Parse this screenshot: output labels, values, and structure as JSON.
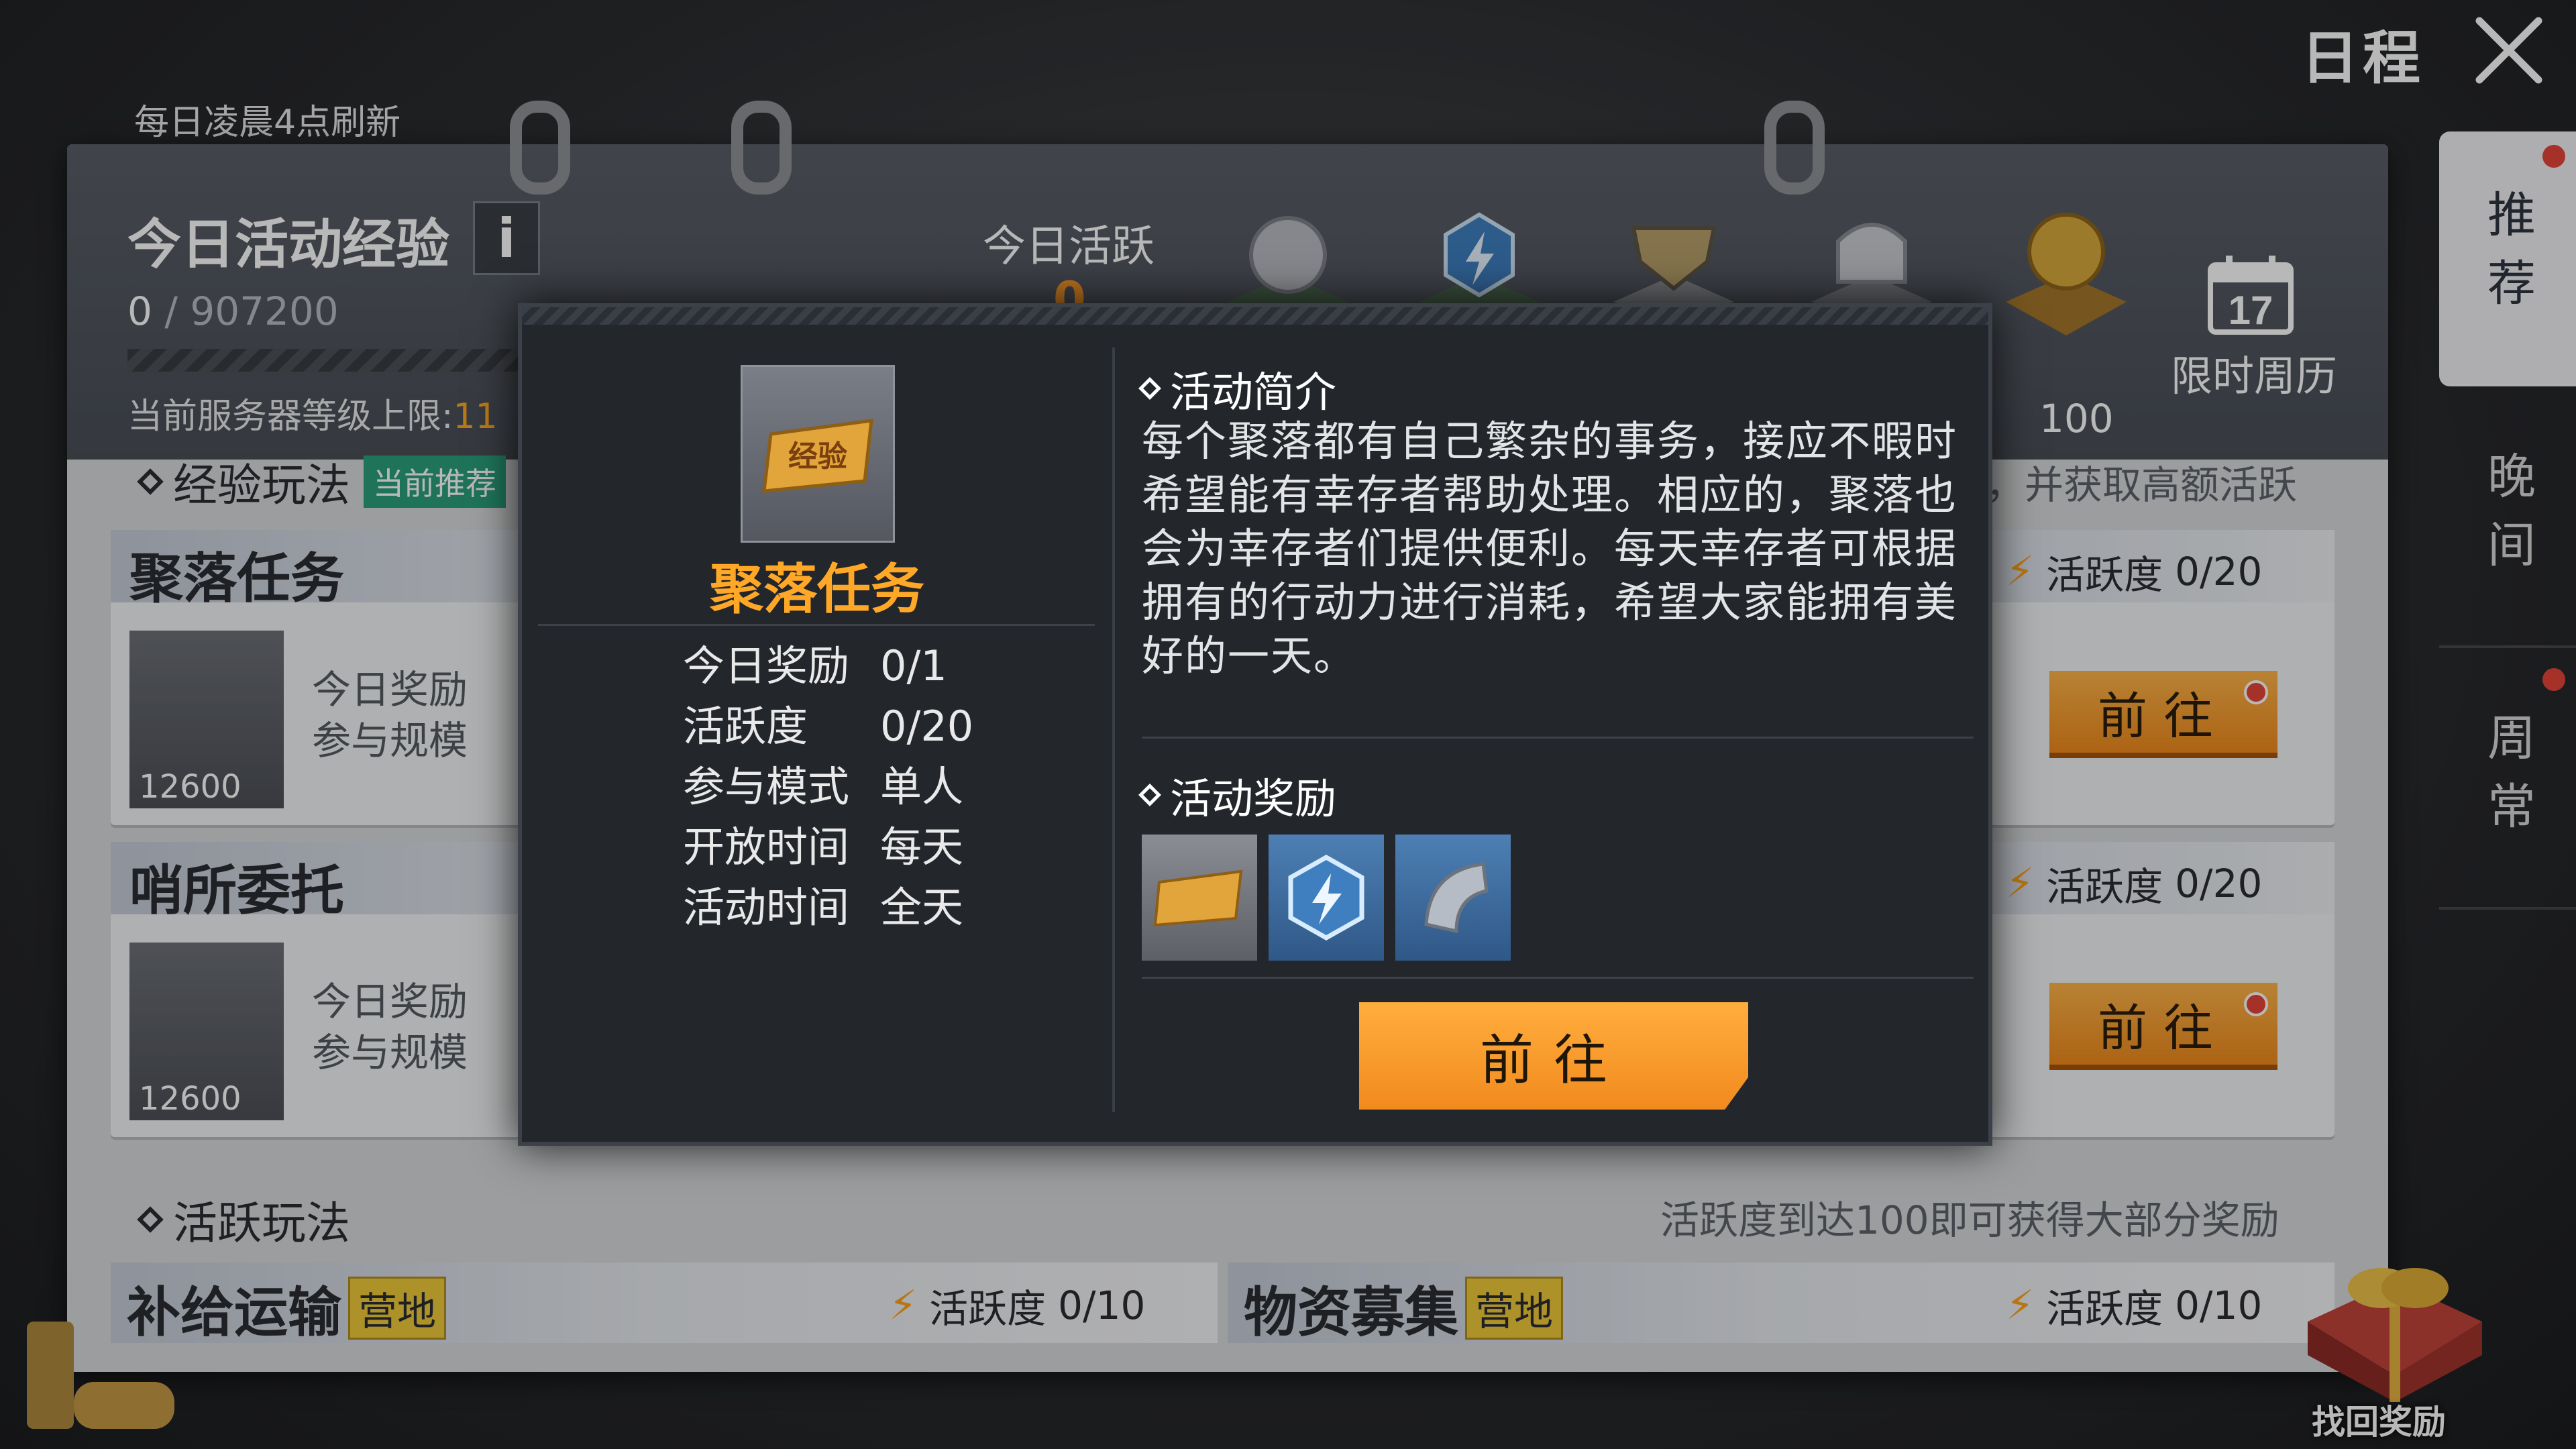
{
  "header": {
    "title": "日程"
  },
  "refresh_note": "每日凌晨4点刷新",
  "right_tabs": [
    {
      "label": "推荐",
      "active": true,
      "has_dot": true
    },
    {
      "label": "晚间",
      "active": false,
      "has_dot": false
    },
    {
      "label": "周常",
      "active": false,
      "has_dot": true
    }
  ],
  "exp": {
    "title": "今日活动经验",
    "info_label": "i",
    "current": "0",
    "separator": "/",
    "max": "907200",
    "server_limit_label": "当前服务器等级上限:",
    "server_limit_value": "11",
    "progress": 0.0
  },
  "activity": {
    "today_label": "今日活跃",
    "today_value": "0",
    "chest_value": "100",
    "calendar_day": "17",
    "calendar_label": "限时周历"
  },
  "sections": {
    "exp_play": {
      "title": "经验玩法",
      "badge": "当前推荐",
      "note": "，并获取高额活跃"
    },
    "active_play": {
      "title": "活跃玩法",
      "note": "活跃度到达100即可获得大部分奖励"
    }
  },
  "cards": [
    {
      "title": "聚落任务",
      "icon_value": "12600",
      "info_lines": [
        "今日奖励",
        "参与规模"
      ],
      "active_label": "活跃度",
      "active_value": "0/20",
      "go_label": "前往"
    },
    {
      "title": "哨所委托",
      "icon_value": "12600",
      "info_lines": [
        "今日奖励",
        "参与规模"
      ],
      "active_label": "活跃度",
      "active_value": "0/20",
      "go_label": "前往"
    }
  ],
  "strips": [
    {
      "title": "补给运输",
      "badge": "营地",
      "active_label": "活跃度",
      "active_value": "0/10"
    },
    {
      "title": "物资募集",
      "badge": "营地",
      "active_label": "活跃度",
      "active_value": "0/10"
    }
  ],
  "popup": {
    "item_label": "经验",
    "name": "聚落任务",
    "rows": [
      {
        "k": "今日奖励",
        "v": "0/1"
      },
      {
        "k": "活跃度",
        "v": "0/20"
      },
      {
        "k": "参与模式",
        "v": "单人"
      },
      {
        "k": "开放时间",
        "v": "每天"
      },
      {
        "k": "活动时间",
        "v": "全天"
      }
    ],
    "intro_title": "活动简介",
    "intro_text": "每个聚落都有自己繁杂的事务，接应不暇时希望能有幸存者帮助处理。相应的，聚落也会为幸存者们提供便利。每天幸存者可根据拥有的行动力进行消耗，希望大家能拥有美好的一天。",
    "reward_title": "活动奖励",
    "go_label": "前往"
  },
  "gift": {
    "label": "找回奖励"
  },
  "colors": {
    "accent": "#f28a1e",
    "title_orange": "#ffa828",
    "badge_green": "#2aa07c",
    "dot_red": "#e6443a"
  }
}
